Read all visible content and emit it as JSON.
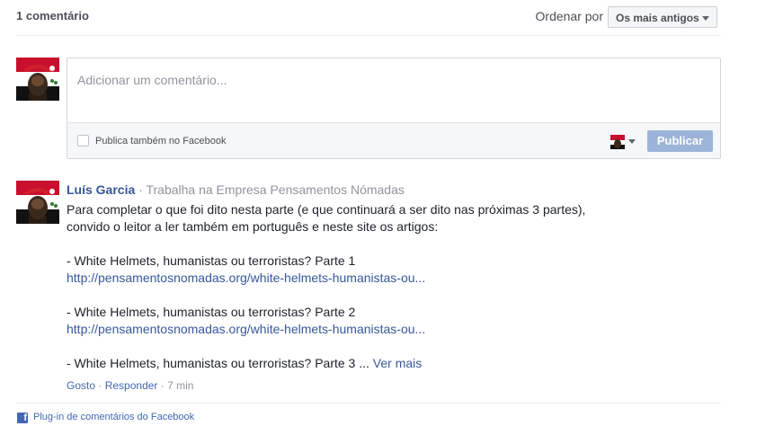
{
  "header": {
    "comment_count": "1 comentário",
    "order_label": "Ordenar por",
    "order_selected": "Os mais antigos"
  },
  "composer": {
    "placeholder": "Adicionar um comentário...",
    "value": "",
    "share_checkbox_label": "Publica também no Facebook",
    "share_checked": false,
    "publish_label": "Publicar"
  },
  "comment": {
    "author": "Luís Garcia",
    "separator": "·",
    "work": "Trabalha na Empresa Pensamentos Nómadas",
    "text_line_1": "Para completar o que foi dito nesta parte (e que continuará a ser dito nas próximas 3 partes),",
    "text_line_2": "convido o leitor a ler também em português e neste site os artigos:",
    "item_1_title": "- White Helmets, humanistas ou terroristas? Parte 1",
    "item_1_link": "http://pensamentosnomadas.org/white-helmets-humanistas-ou...",
    "item_2_title": "- White Helmets, humanistas ou terroristas? Parte 2",
    "item_2_link": "http://pensamentosnomadas.org/white-helmets-humanistas-ou...",
    "item_3_title": "- White Helmets, humanistas ou terroristas? Parte 3",
    "ellipsis": " ... ",
    "see_more": "Ver mais",
    "like": "Gosto",
    "reply": "Responder",
    "time": "7 min"
  },
  "footer": {
    "plugin_label": "Plug-in de comentários do Facebook"
  },
  "colors": {
    "link": "#365899",
    "publish_disabled": "#9cb4d8",
    "muted": "#90949c"
  }
}
